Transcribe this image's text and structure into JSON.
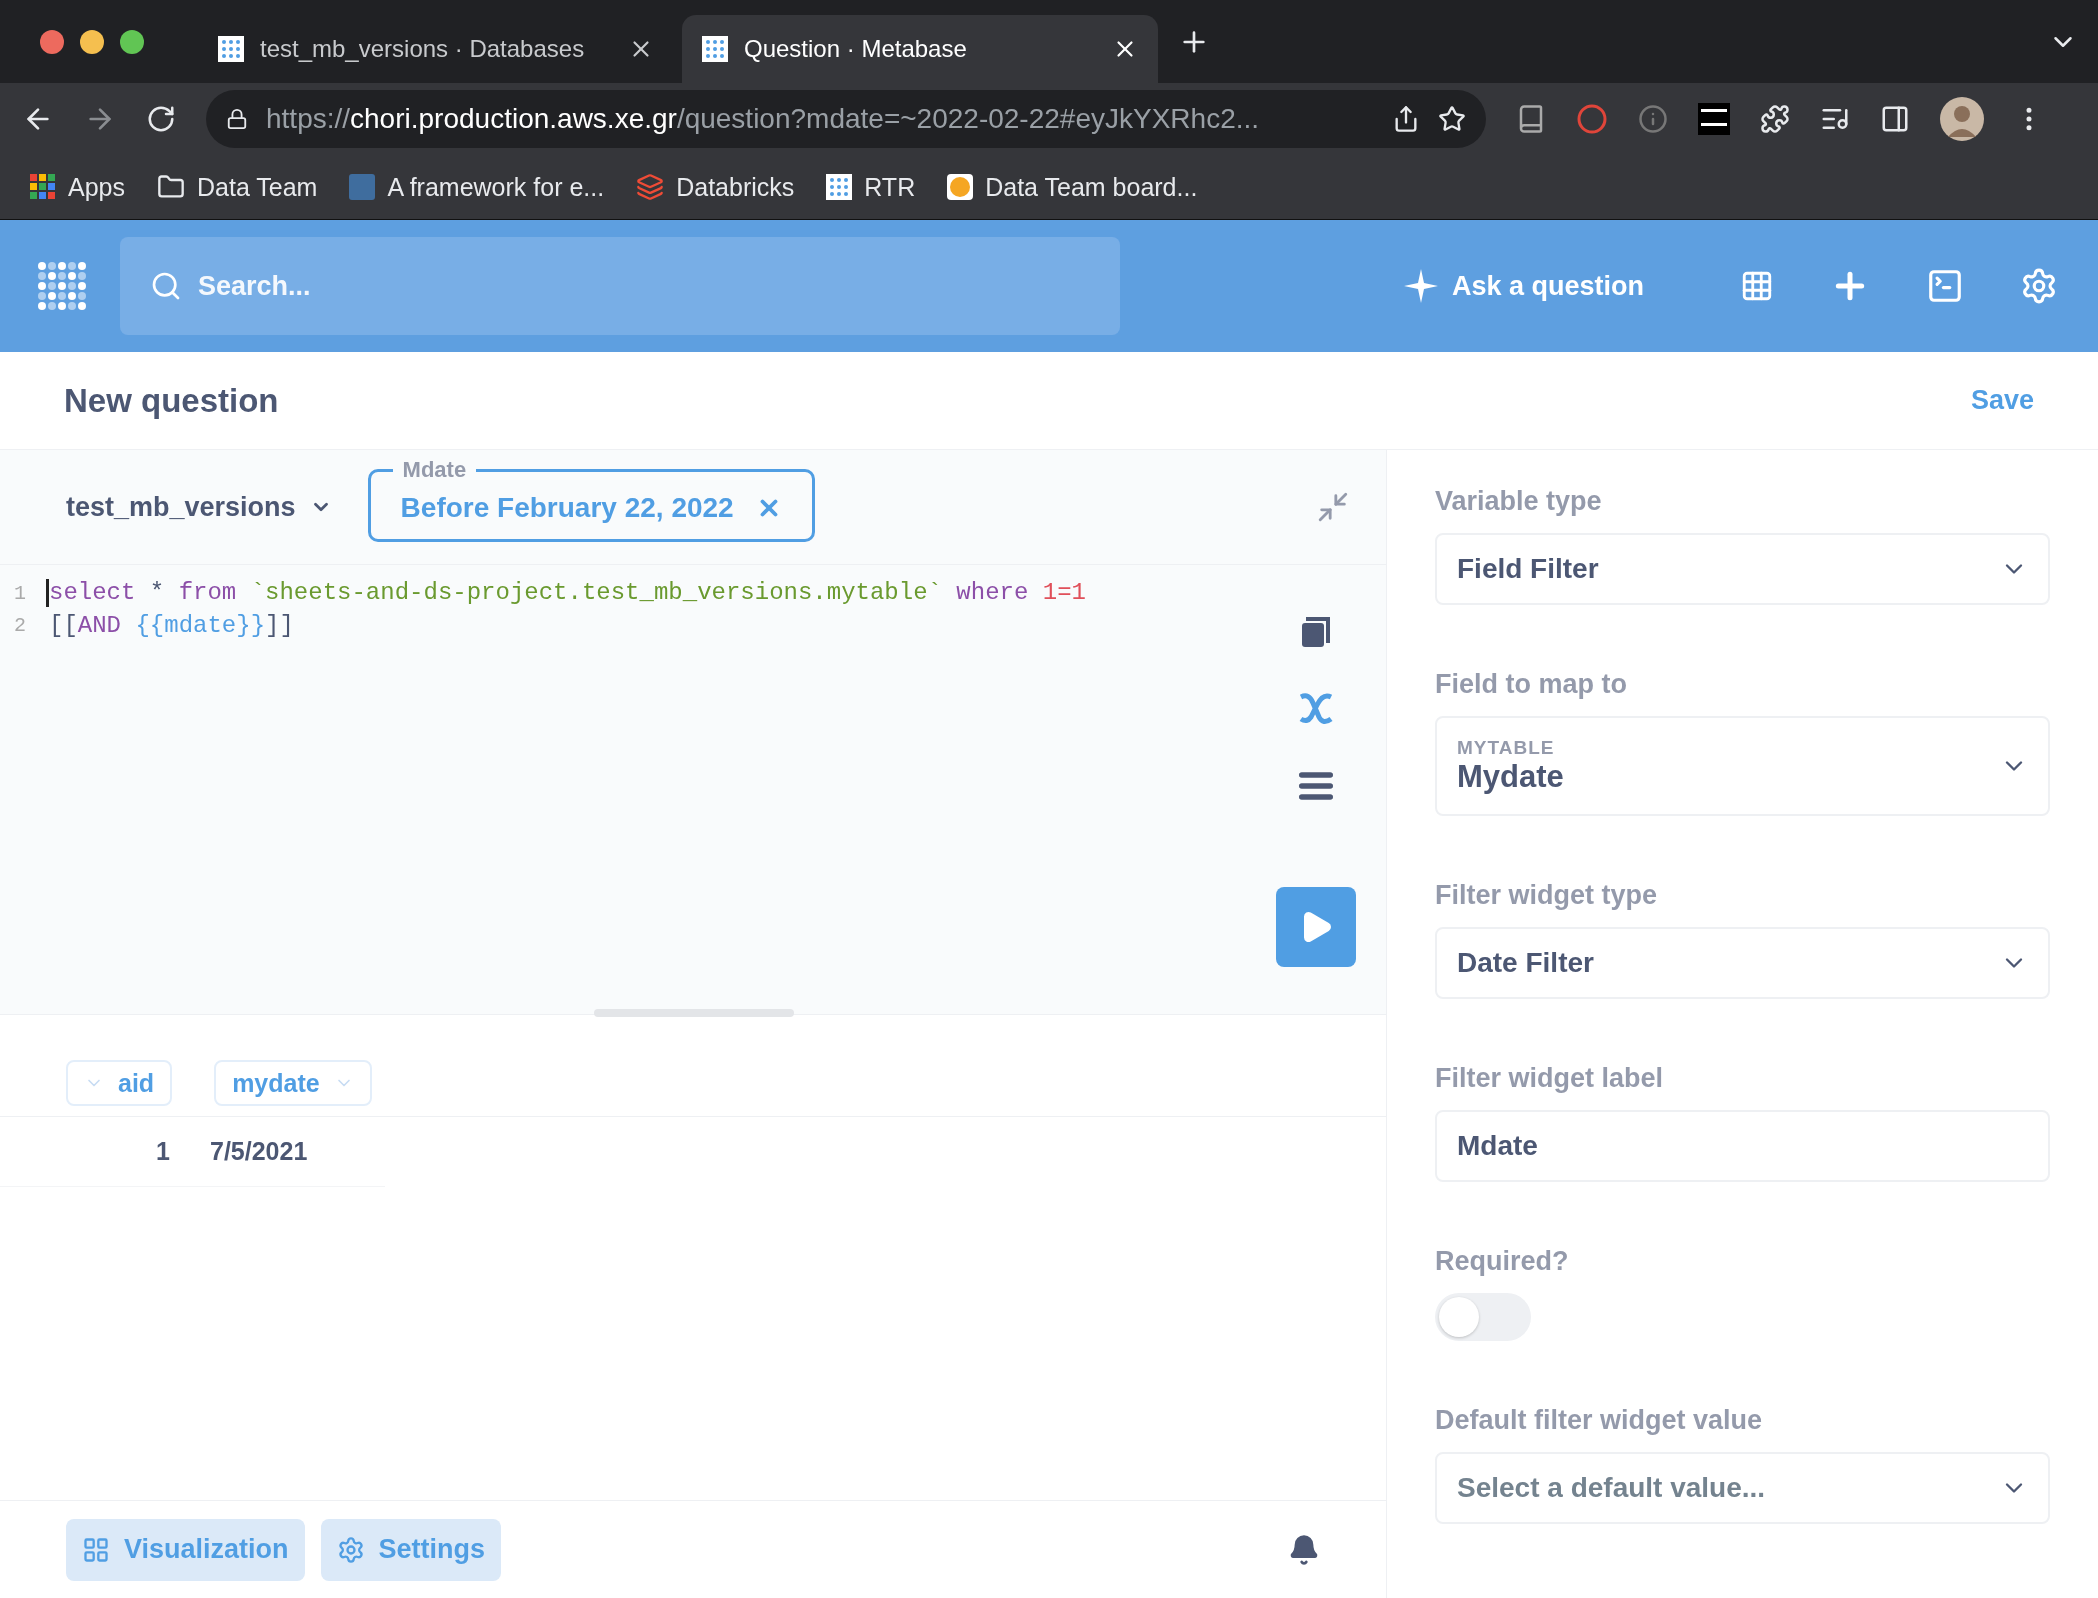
{
  "browser": {
    "tabs": [
      {
        "title": "test_mb_versions · Databases",
        "selected": false
      },
      {
        "title": "Question · Metabase",
        "selected": true
      }
    ],
    "url": {
      "scheme": "https://",
      "host": "chori.production.aws.xe.gr",
      "path": "/question?mdate=~2022-02-22#eyJkYXRhc2..."
    },
    "bookmarks": [
      {
        "label": "Apps",
        "kind": "apps"
      },
      {
        "label": "Data Team",
        "kind": "folder"
      },
      {
        "label": "A framework for e...",
        "kind": "tds"
      },
      {
        "label": "Databricks",
        "kind": "databricks"
      },
      {
        "label": "RTR",
        "kind": "metabase"
      },
      {
        "label": "Data Team board...",
        "kind": "xe"
      }
    ]
  },
  "nav": {
    "search": {
      "placeholder": "Search..."
    },
    "ask": "Ask a question"
  },
  "header": {
    "title": "New question",
    "save": "Save"
  },
  "editor": {
    "database": "test_mb_versions",
    "parameter": {
      "label": "Mdate",
      "value": "Before February 22, 2022"
    },
    "lines": [
      {
        "number": "1",
        "tokens": [
          {
            "kind": "keyword",
            "text": "select"
          },
          {
            "kind": "plain",
            "text": " * "
          },
          {
            "kind": "keyword",
            "text": "from"
          },
          {
            "kind": "string",
            "text": " `sheets-and-ds-project.test_mb_versions.mytable`"
          },
          {
            "kind": "keyword",
            "text": " where"
          },
          {
            "kind": "number",
            "text": " 1=1"
          }
        ]
      },
      {
        "number": "2",
        "tokens": [
          {
            "kind": "plain",
            "text": "[["
          },
          {
            "kind": "keyword",
            "text": "AND"
          },
          {
            "kind": "variable",
            "text": " {{mdate}}"
          },
          {
            "kind": "plain",
            "text": "]]"
          }
        ]
      }
    ]
  },
  "results": {
    "columns": [
      {
        "name": "aid",
        "kind": "number"
      },
      {
        "name": "mydate",
        "kind": "text"
      }
    ],
    "rows": [
      [
        "1",
        "7/5/2021"
      ]
    ]
  },
  "footer": {
    "buttons": [
      {
        "label": "Visualization",
        "kind": "grid"
      },
      {
        "label": "Settings",
        "kind": "gear"
      }
    ]
  },
  "sidebar": {
    "fields": [
      {
        "kind": "select",
        "label": "Variable type",
        "value": "Field Filter"
      },
      {
        "kind": "field",
        "label": "Field to map to",
        "table": "MYTABLE",
        "value": "Mydate"
      },
      {
        "kind": "select",
        "label": "Filter widget type",
        "value": "Date Filter"
      },
      {
        "kind": "input",
        "label": "Filter widget label",
        "value": "Mdate"
      },
      {
        "kind": "toggle",
        "label": "Required?",
        "on": false
      },
      {
        "kind": "select",
        "label": "Default filter widget value",
        "placeholder": "Select a default value..."
      }
    ]
  }
}
